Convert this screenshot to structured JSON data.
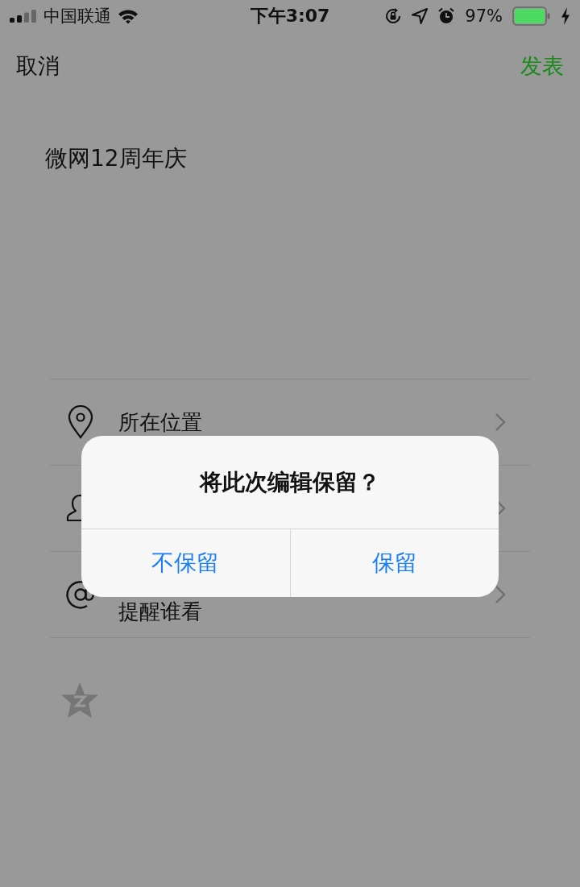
{
  "status_bar": {
    "carrier": "中国联通",
    "time": "下午3:07",
    "battery_percent": "97%"
  },
  "nav": {
    "cancel": "取消",
    "publish": "发表"
  },
  "post": {
    "text": "微网12周年庆"
  },
  "options": [
    {
      "kind": "location",
      "label": "所在位置"
    },
    {
      "kind": "visibility"
    },
    {
      "kind": "mention",
      "label": "提醒谁看"
    }
  ],
  "dialog": {
    "title": "将此次编辑保留？",
    "buttons": [
      "不保留",
      "保留"
    ]
  }
}
